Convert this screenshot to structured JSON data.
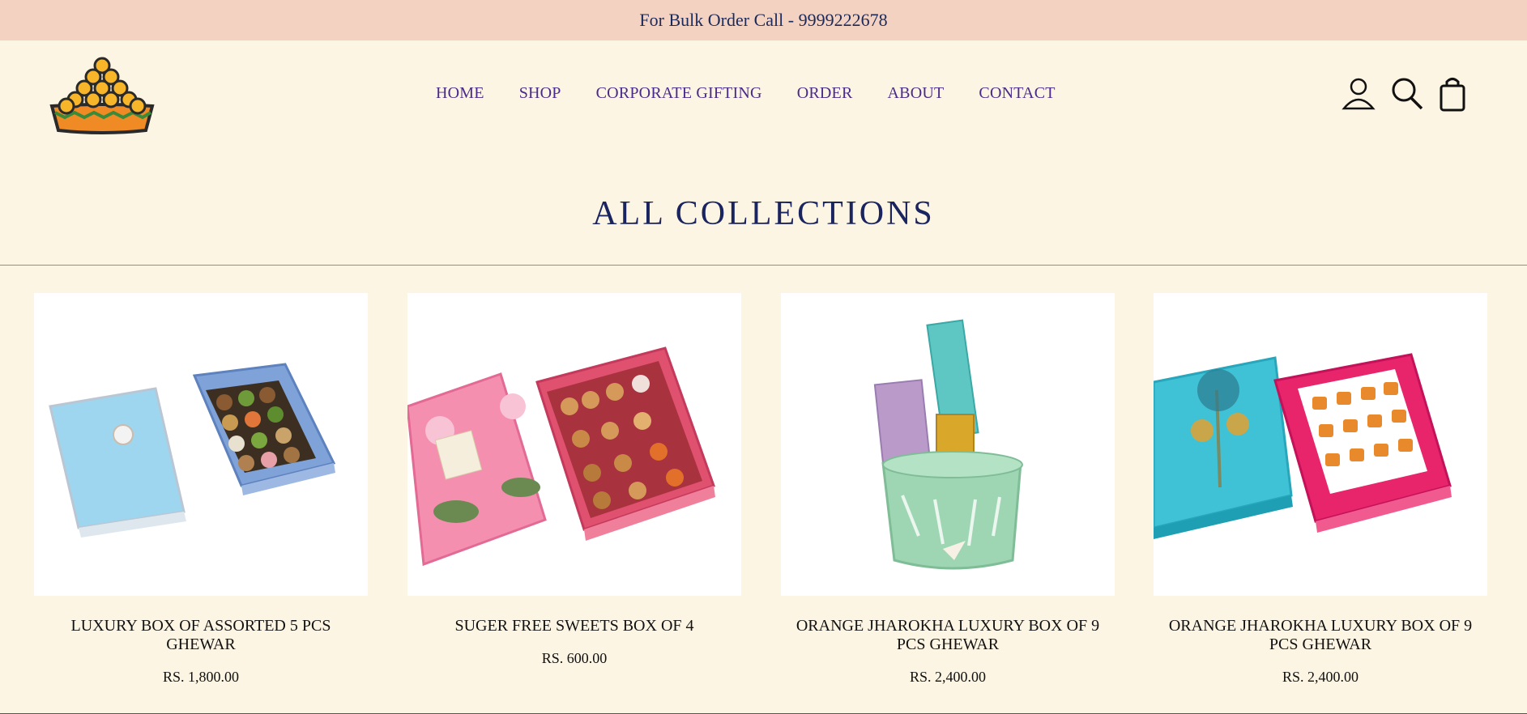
{
  "topbar": {
    "text": "For Bulk Order Call - 9999222678"
  },
  "header": {
    "logo_icon": "laddoo-pyramid-logo",
    "nav": [
      {
        "label": "HOME"
      },
      {
        "label": "SHOP"
      },
      {
        "label": "CORPORATE GIFTING"
      },
      {
        "label": "ORDER"
      },
      {
        "label": "ABOUT"
      },
      {
        "label": "CONTACT"
      }
    ],
    "icons": [
      "user-icon",
      "search-icon",
      "shopping-bag-icon"
    ]
  },
  "main": {
    "title": "ALL COLLECTIONS",
    "products": [
      {
        "name": "LUXURY BOX OF ASSORTED 5 PCS GHEWAR",
        "price": "RS. 1,800.00"
      },
      {
        "name": "SUGER FREE SWEETS BOX OF 4",
        "price": "RS. 600.00"
      },
      {
        "name": "ORANGE JHAROKHA LUXURY BOX OF 9 PCS GHEWAR",
        "price": "RS. 2,400.00"
      },
      {
        "name": "ORANGE JHAROKHA LUXURY BOX OF 9 PCS GHEWAR",
        "price": "RS. 2,400.00"
      }
    ]
  },
  "colors": {
    "topbar_bg": "#f3d2c2",
    "page_bg": "#fdf5e4",
    "nav_text": "#4a2a8a",
    "title_text": "#1a2560"
  }
}
